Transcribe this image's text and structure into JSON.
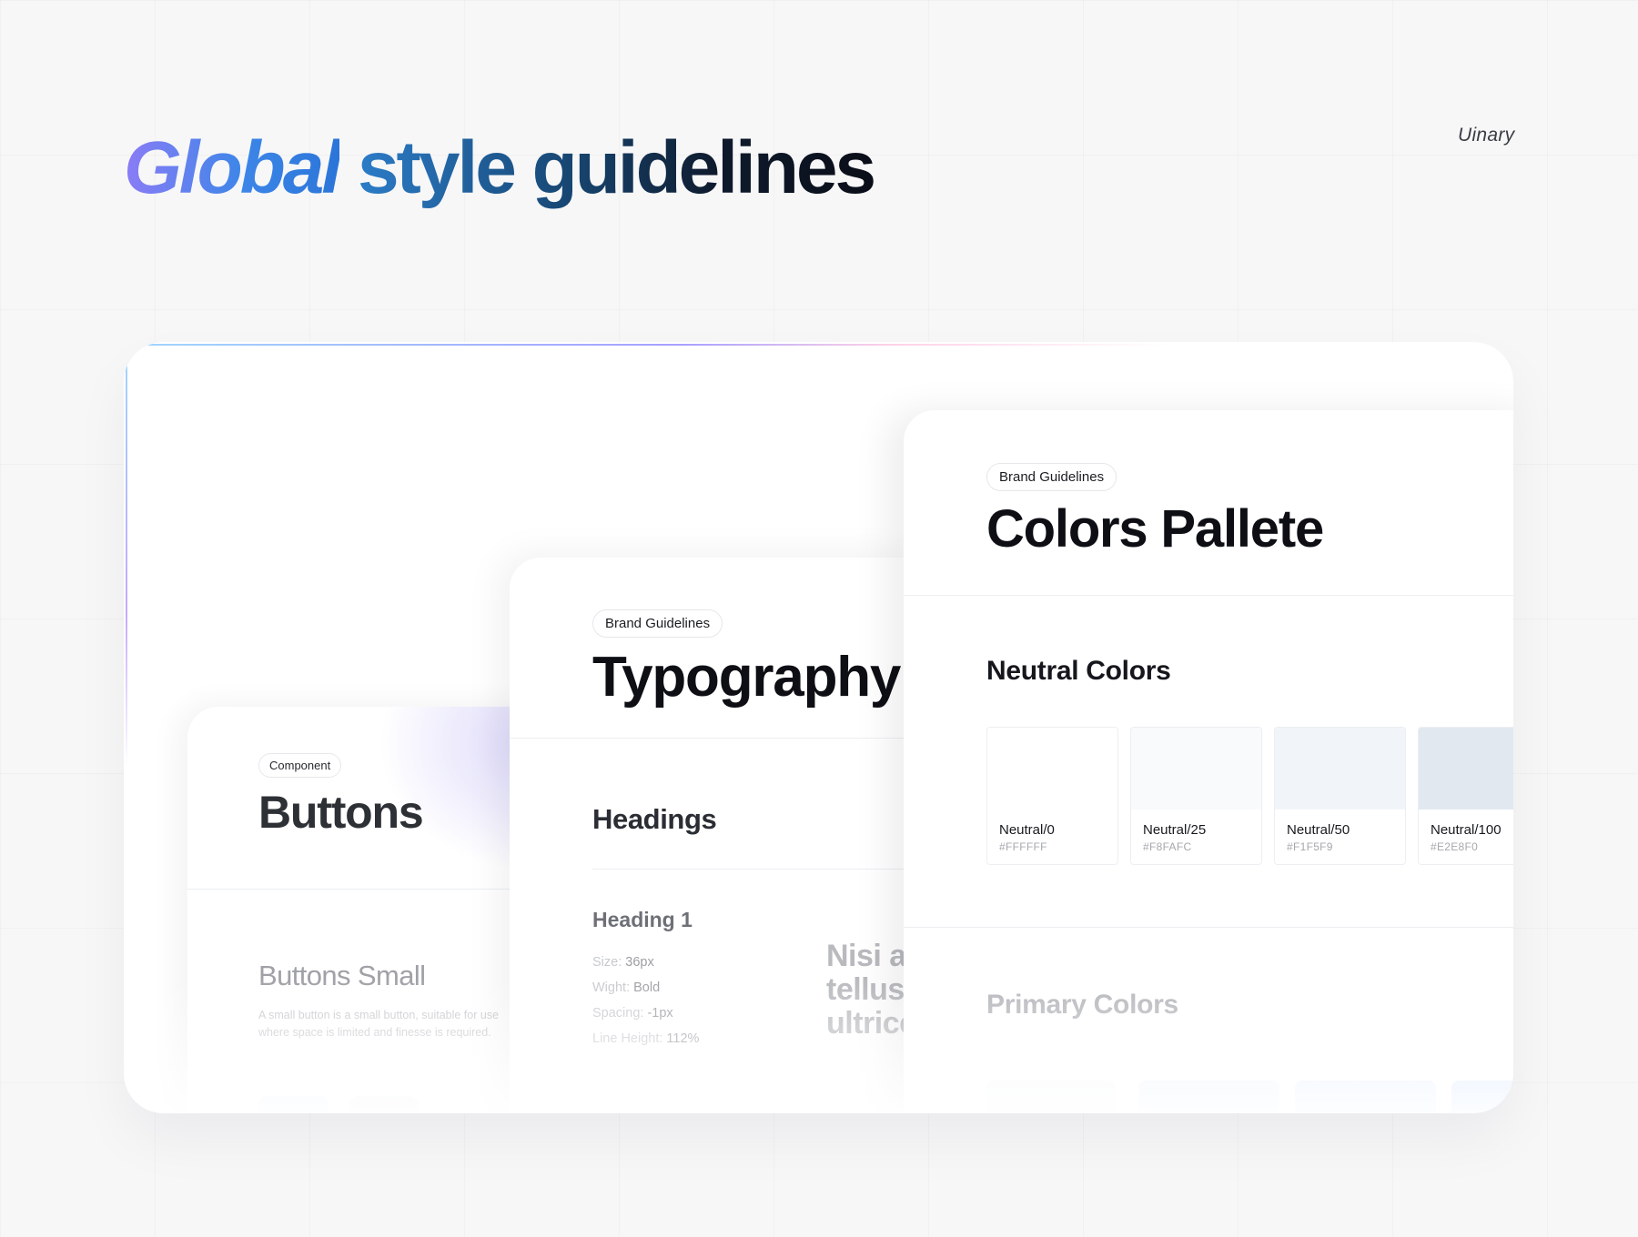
{
  "header": {
    "title_highlight": "Global",
    "title_rest": "style guidelines",
    "brand": "Uinary"
  },
  "buttons_card": {
    "chip": "Component",
    "title": "Buttons",
    "subtitle": "Buttons Small",
    "description": "A small button is a small button, suitable for use where space is limited and finesse is required."
  },
  "typography_card": {
    "chip": "Brand Guidelines",
    "title": "Typography (",
    "section": "Headings",
    "heading_label": "Heading 1",
    "specs": [
      {
        "label": "Size:",
        "value": "36px"
      },
      {
        "label": "Wight:",
        "value": "Bold"
      },
      {
        "label": "Spacing:",
        "value": "-1px"
      },
      {
        "label": "Line Height:",
        "value": "112%"
      }
    ],
    "preview_lines": [
      "Nisi ac",
      "tellus.",
      "ultrice"
    ]
  },
  "colors_card": {
    "chip": "Brand Guidelines",
    "title": "Colors Pallete",
    "neutral_section": "Neutral Colors",
    "swatches": [
      {
        "name": "Neutral/0",
        "hex": "#FFFFFF",
        "color": "#FFFFFF"
      },
      {
        "name": "Neutral/25",
        "hex": "#F8FAFC",
        "color": "#F8FAFC"
      },
      {
        "name": "Neutral/50",
        "hex": "#F1F5F9",
        "color": "#F1F5F9"
      },
      {
        "name": "Neutral/100",
        "hex": "#E2E8F0",
        "color": "#E2E8F0"
      }
    ],
    "primary_section": "Primary Colors"
  },
  "colors": {
    "accent_purple": "#8b7cf6",
    "accent_blue": "#3d86e8",
    "ink": "#0a0e18"
  }
}
